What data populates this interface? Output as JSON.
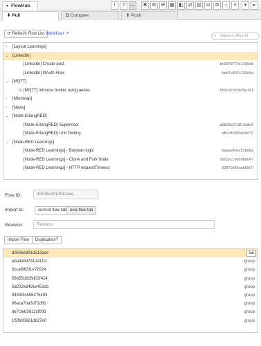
{
  "header": {
    "title": "FlowHub"
  },
  "tabs": [
    {
      "label": "Pull",
      "icon": "download-icon"
    },
    {
      "label": "Compare",
      "icon": "compare-icon"
    },
    {
      "label": "Push",
      "icon": "upload-icon"
    }
  ],
  "toolbar": {
    "refresh_label": "Refresh Flow List",
    "webiliser_label": "Webiliser",
    "search_placeholder": "Name or Flow Id"
  },
  "tree": [
    {
      "label": "[Layout Learnings]",
      "type": "group",
      "expanded": false
    },
    {
      "label": "[LinkedIn]",
      "type": "group",
      "expanded": true,
      "highlighted": true
    },
    {
      "label": "[LinkedIn] Create post",
      "type": "flow",
      "id": "bc9878770c1350d8"
    },
    {
      "label": "[LinkedIn] OAuth Flow",
      "type": "flow",
      "id": "fafd7c807c192d4a"
    },
    {
      "label": "[MQTT]",
      "type": "group",
      "expanded": true
    },
    {
      "label": "[MQTT] Inhouse broker using aedes",
      "type": "flow-dot",
      "id": "553ca20c0b35e191"
    },
    {
      "label": "[Mindmap]",
      "type": "group",
      "expanded": false
    },
    {
      "label": "[News]",
      "type": "group",
      "expanded": false
    },
    {
      "label": "[Node-ErlangRED]",
      "type": "group",
      "expanded": true
    },
    {
      "label": "[Node-ErlangRED] Supervisor",
      "type": "flow",
      "id": "d5b52b27a813a8c0"
    },
    {
      "label": "[Node-ErlangRED] Unit Testing",
      "type": "flow",
      "id": "ef91cb280a1bfd72"
    },
    {
      "label": "[Node-RED Learnings]",
      "type": "group",
      "expanded": true
    },
    {
      "label": "[Node-RED Learnings] - Boolean logic",
      "type": "flow",
      "id": "baaaa40ec51bdba"
    },
    {
      "label": "[Node-RED Learnings] - Clone and Fork Node",
      "type": "flow",
      "id": "3661ec196698b047"
    },
    {
      "label": "[Node-RED Learnings] - HTTP requestTimeout",
      "type": "flow",
      "id": "60871bf5eadd6d7f"
    }
  ],
  "form": {
    "flow_id_label": "Flow ID:",
    "flow_id_value": "d0506e991d512ace",
    "import_to_label": "Import to:",
    "current_flow_tab": "current flow tab",
    "new_flow_tab": "new flow tab",
    "revision_label": "Revision:",
    "revision_placeholder": "Revision",
    "import_flow_button": "Import Flow",
    "duplication_button": "Duplication?"
  },
  "import_list": [
    {
      "id": "d0506e991d512ace",
      "type": "tab",
      "highlighted": true
    },
    {
      "id": "aba9a5d741241f1c",
      "type": "group"
    },
    {
      "id": "3ccaf963f1e72024",
      "type": "group"
    },
    {
      "id": "56b55d2b5d02f424",
      "type": "group"
    },
    {
      "id": "5d202e6481e451cb",
      "type": "group"
    },
    {
      "id": "94fb93c698275493",
      "type": "group"
    },
    {
      "id": "88aca7ba3d72dff1",
      "type": "group"
    },
    {
      "id": "de7cfeb5612cf008",
      "type": "group"
    },
    {
      "id": "1f5fb00661db27e0",
      "type": "group"
    }
  ]
}
